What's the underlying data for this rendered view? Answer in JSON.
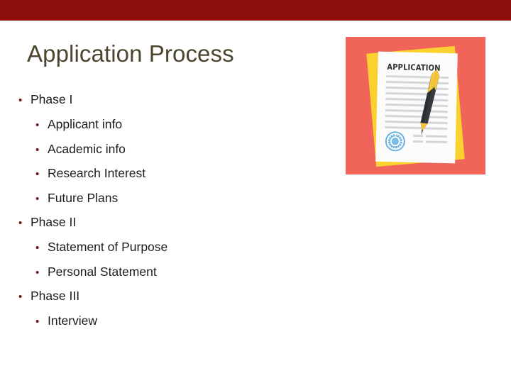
{
  "slide": {
    "title": "Application Process",
    "top_bar_color": "#8a0f0a",
    "title_color": "#4c4530",
    "background_color": "#ffffff"
  },
  "bullets": [
    {
      "level": 1,
      "marker": "•",
      "text": "Phase I"
    },
    {
      "level": 2,
      "marker": "•",
      "text": "Applicant info"
    },
    {
      "level": 2,
      "marker": "•",
      "text": "Academic info"
    },
    {
      "level": 2,
      "marker": "•",
      "text": "Research Interest"
    },
    {
      "level": 2,
      "marker": "•",
      "text": "Future Plans"
    },
    {
      "level": 1,
      "marker": "•",
      "text": "Phase II"
    },
    {
      "level": 2,
      "marker": "•",
      "text": "Statement of Purpose"
    },
    {
      "level": 2,
      "marker": "•",
      "text": "Personal Statement"
    },
    {
      "level": 1,
      "marker": "•",
      "text": "Phase III"
    },
    {
      "level": 2,
      "marker": "•",
      "text": "Interview"
    }
  ],
  "illustration": {
    "name": "application-form-illustration",
    "background_color": "#f0645a",
    "back_sheet_color": "#fbd130",
    "form_sheet_color": "#fcfcfc",
    "form_heading": "APPLICATION",
    "form_heading_color": "#2e3033",
    "rule_color": "#d3d6da",
    "seal_color": "#6ab3e0",
    "pen_body_color": "#36393f",
    "pen_accent_color": "#f5c63c"
  }
}
